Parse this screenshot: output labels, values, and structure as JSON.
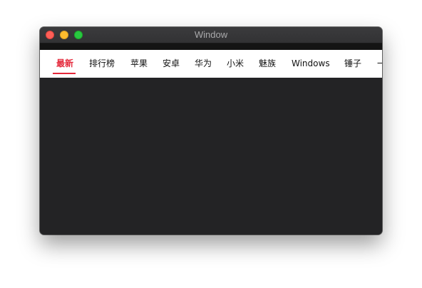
{
  "window": {
    "title": "Window"
  },
  "nav": {
    "tabs": [
      {
        "label": "最新",
        "active": true
      },
      {
        "label": "排行榜",
        "active": false
      },
      {
        "label": "苹果",
        "active": false
      },
      {
        "label": "安卓",
        "active": false
      },
      {
        "label": "华为",
        "active": false
      },
      {
        "label": "小米",
        "active": false
      },
      {
        "label": "魅族",
        "active": false
      },
      {
        "label": "Windows",
        "active": false
      },
      {
        "label": "锤子",
        "active": false
      }
    ],
    "overflow_label": "一"
  },
  "colors": {
    "accent": "#e4283a",
    "window_bg": "#232325",
    "titlebar_bg": "#363638",
    "nav_bg": "#ffffff"
  }
}
